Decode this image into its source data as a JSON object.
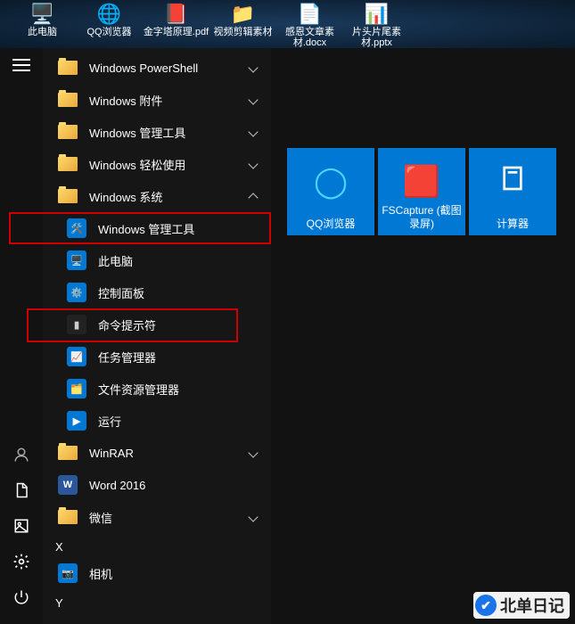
{
  "desktop": [
    {
      "label": "此电脑",
      "icon": "🖥️"
    },
    {
      "label": "QQ浏览器",
      "icon": "🌐"
    },
    {
      "label": "金字塔原理.pdf",
      "icon": "📕"
    },
    {
      "label": "视频剪辑素材",
      "icon": "📁"
    },
    {
      "label": "感恩文章素材.docx",
      "icon": "📄"
    },
    {
      "label": "片头片尾素材.pptx",
      "icon": "📊"
    }
  ],
  "start_list": {
    "folders_top": [
      {
        "label": "Windows PowerShell",
        "expandable": true
      },
      {
        "label": "Windows 附件",
        "expandable": true
      },
      {
        "label": "Windows 管理工具",
        "expandable": true
      },
      {
        "label": "Windows 轻松使用",
        "expandable": true
      },
      {
        "label": "Windows 系统",
        "expandable": true,
        "expanded": true
      }
    ],
    "windows_system_children": [
      {
        "label": "Windows 管理工具",
        "icon_bg": "#0078d4",
        "icon": "🛠️"
      },
      {
        "label": "此电脑",
        "icon_bg": "#0078d4",
        "icon": "🖥️"
      },
      {
        "label": "控制面板",
        "icon_bg": "#0078d4",
        "icon": "⚙️"
      },
      {
        "label": "命令提示符",
        "icon_bg": "#222",
        "icon": "▮"
      },
      {
        "label": "任务管理器",
        "icon_bg": "#0078d4",
        "icon": "📈"
      },
      {
        "label": "文件资源管理器",
        "icon_bg": "#0078d4",
        "icon": "🗂️"
      },
      {
        "label": "运行",
        "icon_bg": "#0078d4",
        "icon": "▶"
      }
    ],
    "after": [
      {
        "label": "WinRAR",
        "type": "folder",
        "expandable": true
      },
      {
        "label": "Word 2016",
        "type": "app",
        "icon": "W",
        "icon_bg": "#2b579a"
      },
      {
        "label": "微信",
        "type": "folder",
        "expandable": true
      }
    ],
    "letter_x": "X",
    "x_items": [
      {
        "label": "相机",
        "icon_bg": "#0078d4",
        "icon": "📷"
      }
    ],
    "letter_y": "Y"
  },
  "tiles": [
    {
      "label": "QQ浏览器",
      "icon": "🌐",
      "icon_color": "#4bd6ff"
    },
    {
      "label": "FSCapture (截图录屏)",
      "icon": "🟥",
      "icon_color": "#e33"
    },
    {
      "label": "计算器",
      "icon": "🧮",
      "icon_color": "#fff"
    }
  ],
  "rail": {
    "user": "user",
    "documents": "documents",
    "pictures": "pictures",
    "settings": "settings",
    "power": "power"
  },
  "watermark": "北单日记"
}
